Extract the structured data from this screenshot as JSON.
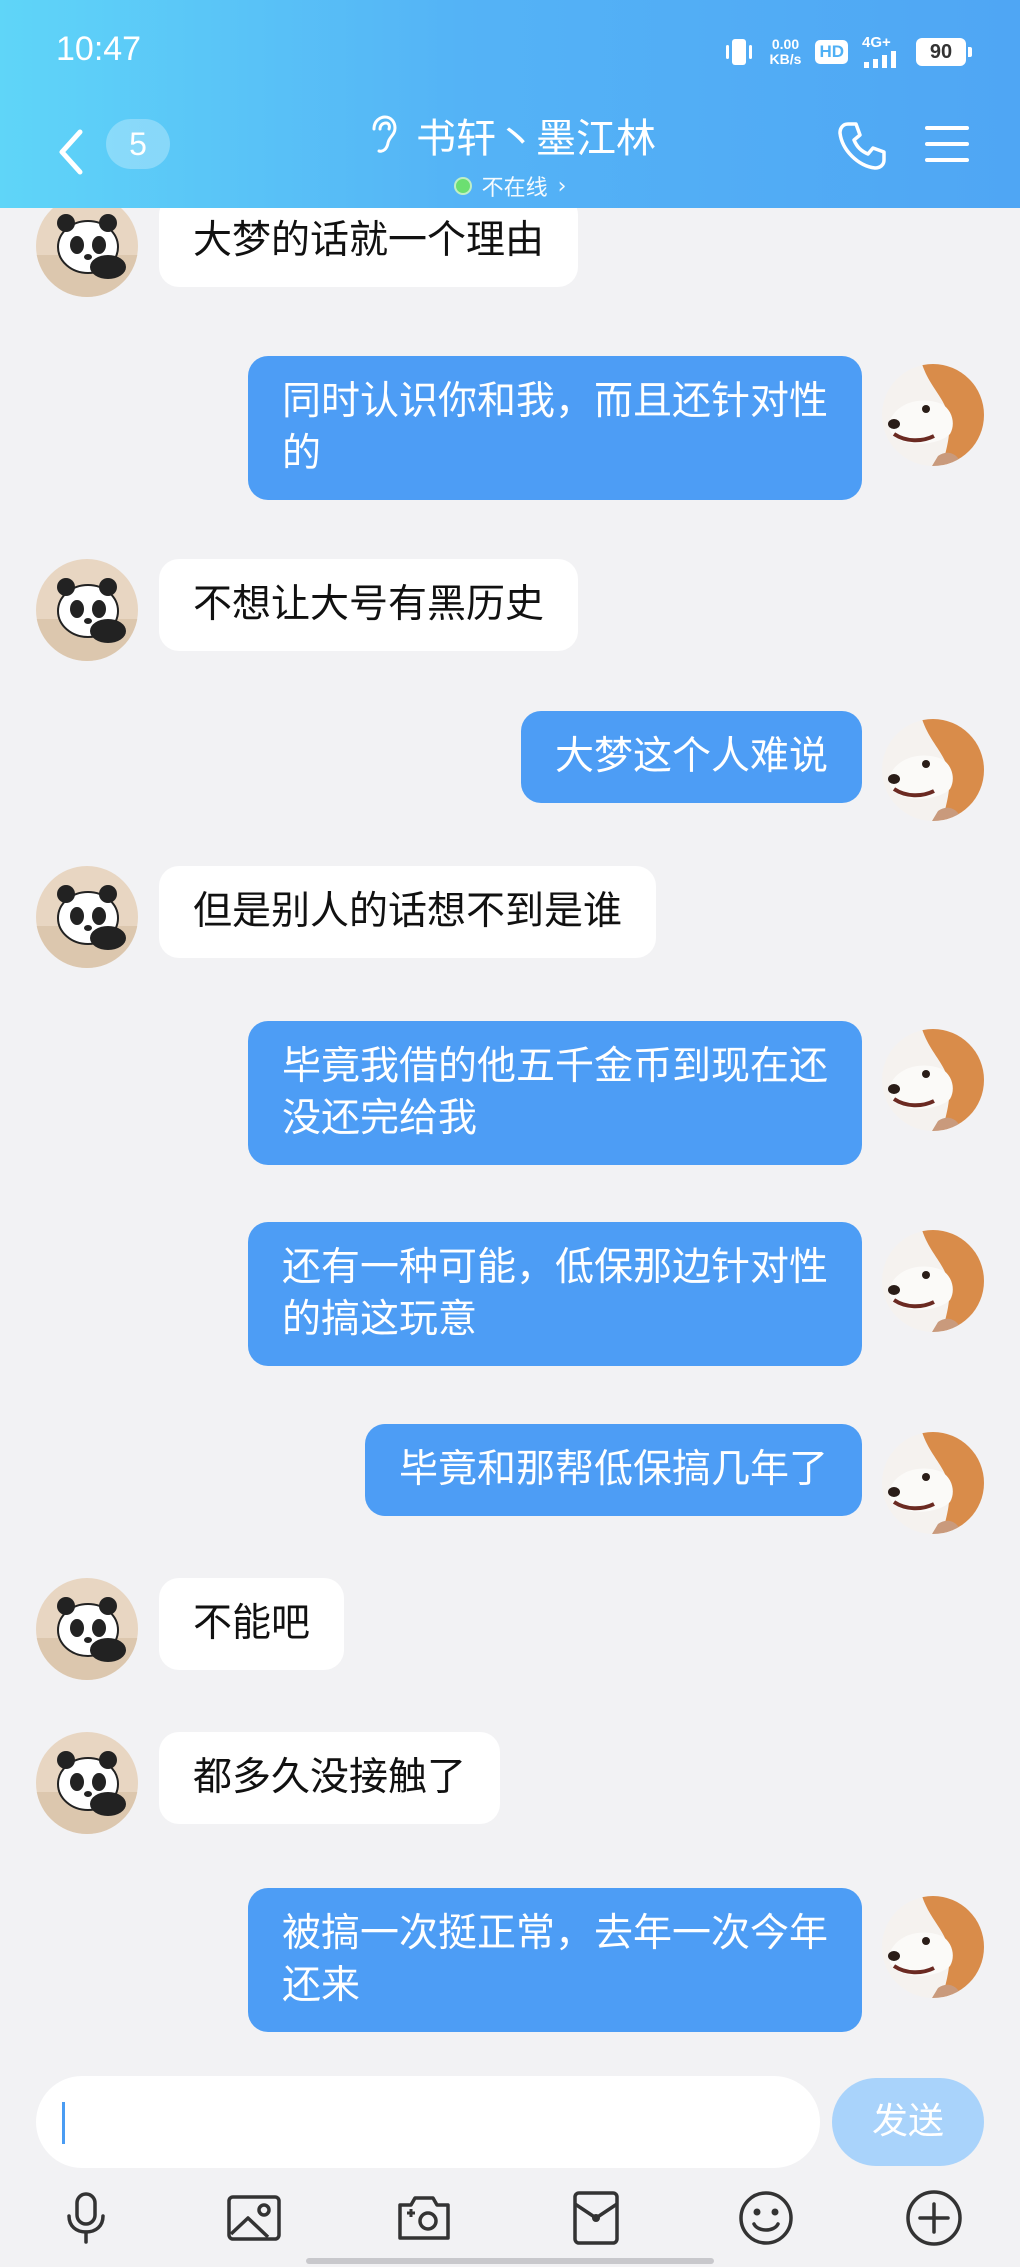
{
  "status_bar": {
    "time": "10:47",
    "net_speed_value": "0.00",
    "net_speed_unit": "KB/s",
    "hd_label": "HD",
    "network_type": "4G+",
    "battery": "90"
  },
  "header": {
    "unread_count": "5",
    "contact_name": "书轩丶墨江林",
    "presence": "不在线",
    "presence_arrow": "›",
    "colors": {
      "gradient_start": "#5fd5f8",
      "gradient_end": "#4fa6f4"
    }
  },
  "messages": [
    {
      "side": "in",
      "text": "大梦的话就一个理由"
    },
    {
      "side": "out",
      "text": "同时认识你和我，而且还针对性\n的"
    },
    {
      "side": "in",
      "text": "不想让大号有黑历史"
    },
    {
      "side": "out",
      "text": "大梦这个人难说"
    },
    {
      "side": "in",
      "text": "但是别人的话想不到是谁"
    },
    {
      "side": "out",
      "text": "毕竟我借的他五千金币到现在还\n没还完给我"
    },
    {
      "side": "out",
      "text": "还有一种可能，低保那边针对性\n的搞这玩意"
    },
    {
      "side": "out",
      "text": "毕竟和那帮低保搞几年了"
    },
    {
      "side": "in",
      "text": "不能吧"
    },
    {
      "side": "in",
      "text": "都多久没接触了"
    },
    {
      "side": "out",
      "text": "被搞一次挺正常，去年一次今年\n还来"
    }
  ],
  "input": {
    "value": "",
    "send_label": "发送"
  },
  "toolbar_icons": [
    "microphone-icon",
    "photo-icon",
    "camera-icon",
    "red-packet-icon",
    "emoji-icon",
    "plus-icon"
  ],
  "colors": {
    "outgoing_bubble": "#4d9df5",
    "incoming_bubble": "#ffffff",
    "background": "#f2f2f4",
    "send_button": "#a9d3fb"
  }
}
